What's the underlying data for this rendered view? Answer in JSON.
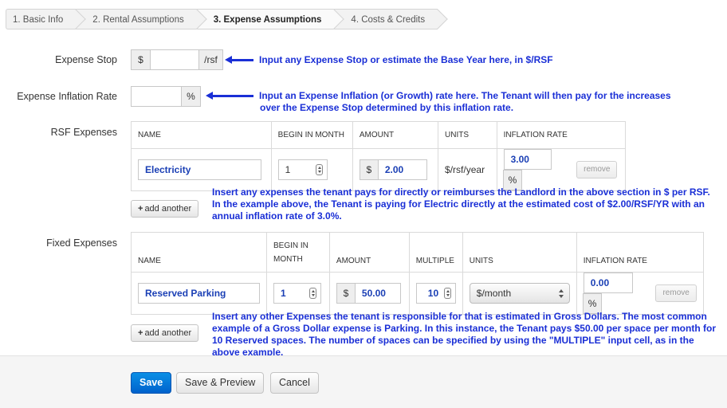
{
  "steps": [
    {
      "label": "1. Basic Info"
    },
    {
      "label": "2. Rental Assumptions"
    },
    {
      "label": "3. Expense Assumptions"
    },
    {
      "label": "4. Costs & Credits"
    }
  ],
  "expense_stop": {
    "label": "Expense Stop",
    "prefix": "$",
    "value": "",
    "suffix": "/rsf"
  },
  "inflation": {
    "label": "Expense Inflation Rate",
    "value": "",
    "suffix": "%"
  },
  "notes": {
    "expense_stop": "Input any Expense Stop or estimate the Base Year here, in $/RSF",
    "inflation_1": "Input an Expense Inflation (or Growth) rate here. The Tenant will then pay for the increases",
    "inflation_2": "over the Expense Stop determined by this inflation rate.",
    "rsf": "Insert any expenses the tenant pays for directly or reimburses the Landlord in the above section in $ per RSF. In the example above, the Tenant is paying for Electric directly at the estimated cost of $2.00/RSF/YR with an annual inflation rate of 3.0%.",
    "fixed": "Insert any other Expenses the tenant is responsible for that is estimated in Gross Dollars. The most common example of a Gross Dollar expense is Parking. In this instance, the Tenant pays $50.00 per space per month for 10 Reserved spaces. The number of spaces can be specified by using the \"MULTIPLE\" input cell, as in the above example."
  },
  "rsf": {
    "label": "RSF Expenses",
    "headers": {
      "name": "NAME",
      "begin": "BEGIN IN MONTH",
      "amount": "AMOUNT",
      "units": "UNITS",
      "inflation": "INFLATION RATE"
    },
    "row": {
      "name": "Electricity",
      "begin": "1",
      "currency": "$",
      "amount": "2.00",
      "units": "$/rsf/year",
      "inflation": "3.00",
      "pct": "%",
      "remove": "remove"
    },
    "add_label": "add another"
  },
  "fixed": {
    "label": "Fixed Expenses",
    "headers": {
      "name": "NAME",
      "begin_1": "BEGIN IN",
      "begin_2": "MONTH",
      "amount": "AMOUNT",
      "multiple": "MULTIPLE",
      "units": "UNITS",
      "inflation": "INFLATION RATE"
    },
    "row": {
      "name": "Reserved Parking",
      "begin": "1",
      "currency": "$",
      "amount": "50.00",
      "multiple": "10",
      "units": "$/month",
      "inflation": "0.00",
      "pct": "%",
      "remove": "remove"
    },
    "add_label": "add another"
  },
  "footer": {
    "save": "Save",
    "save_preview": "Save & Preview",
    "cancel": "Cancel"
  },
  "colors": {
    "annotation": "#1a2fd6",
    "primary": "#0074d9",
    "value_text": "#1a3fb5"
  }
}
